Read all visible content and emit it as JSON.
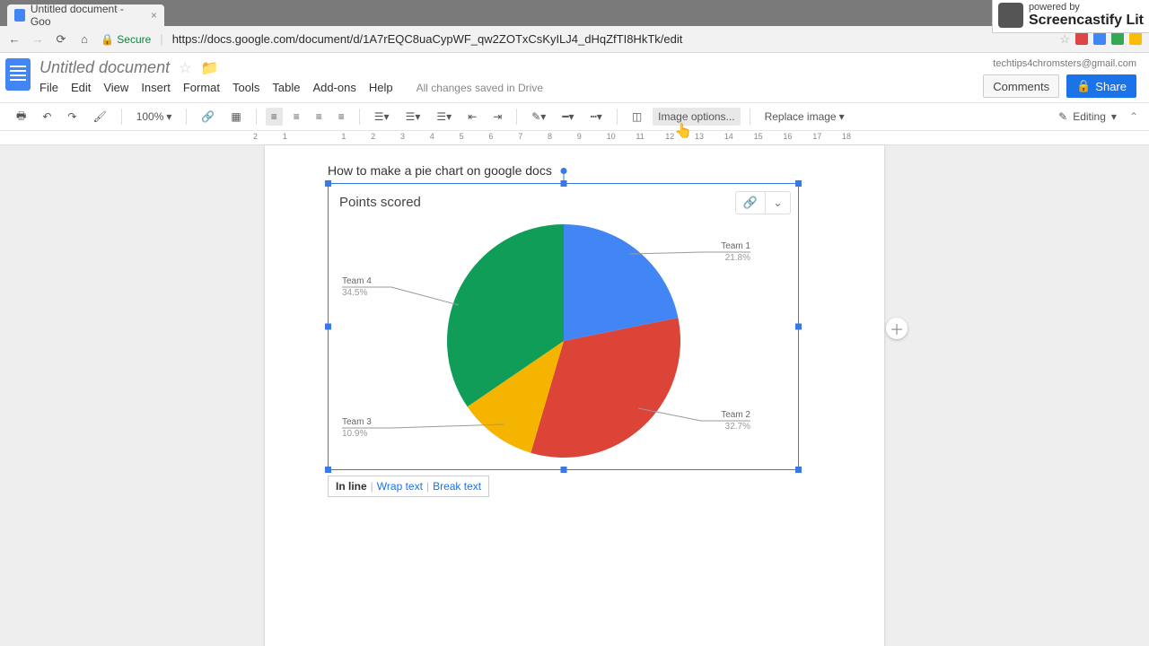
{
  "browser": {
    "tab_title": "Untitled document - Goo",
    "secure_label": "Secure",
    "url": "https://docs.google.com/document/d/1A7rEQC8uaCypWF_qw2ZOTxCsKyILJ4_dHqZfTI8HkTk/edit"
  },
  "header": {
    "doc_title": "Untitled document",
    "email": "techtips4chromsters@gmail.com",
    "comments": "Comments",
    "share": "Share"
  },
  "menu": {
    "file": "File",
    "edit": "Edit",
    "view": "View",
    "insert": "Insert",
    "format": "Format",
    "tools": "Tools",
    "table": "Table",
    "addons": "Add-ons",
    "help": "Help",
    "save_msg": "All changes saved in Drive"
  },
  "toolbar": {
    "zoom": "100%",
    "image_options": "Image options...",
    "replace_image": "Replace image",
    "editing": "Editing"
  },
  "ruler": [
    "2",
    "1",
    "",
    "1",
    "2",
    "3",
    "4",
    "5",
    "6",
    "7",
    "8",
    "9",
    "10",
    "11",
    "12",
    "13",
    "14",
    "15",
    "16",
    "17",
    "18"
  ],
  "document": {
    "para_title": "How to make a pie chart on google docs"
  },
  "wrap": {
    "inline": "In line",
    "wrap": "Wrap text",
    "break": "Break text"
  },
  "watermark": {
    "powered": "powered by",
    "brand": "Screencastify Lit"
  },
  "chart_data": {
    "type": "pie",
    "title": "Points scored",
    "series": [
      {
        "name": "Team 1",
        "value": 21.8,
        "label": "21.8%",
        "color": "#4285f4"
      },
      {
        "name": "Team 2",
        "value": 32.7,
        "label": "32.7%",
        "color": "#db4437"
      },
      {
        "name": "Team 3",
        "value": 10.9,
        "label": "10.9%",
        "color": "#f4b400"
      },
      {
        "name": "Team 4",
        "value": 34.5,
        "label": "34.5%",
        "color": "#0f9d58"
      }
    ]
  }
}
